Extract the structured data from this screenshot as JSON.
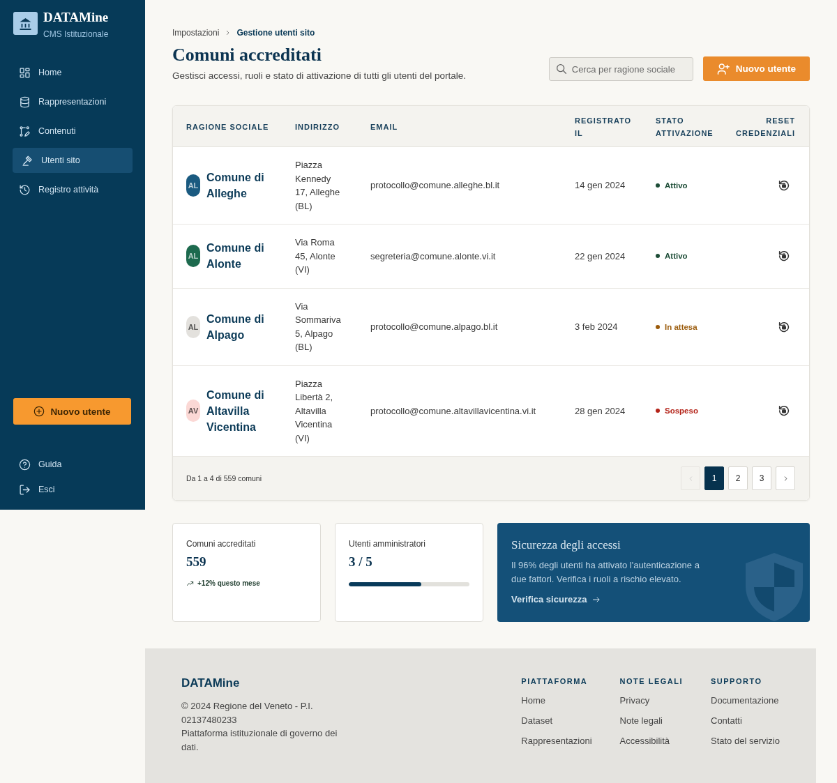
{
  "sidebar": {
    "brand": "DATAMine",
    "subtitle": "CMS Istituzionale",
    "nav": [
      {
        "label": "Home",
        "selected": false
      },
      {
        "label": "Rappresentazioni",
        "selected": false
      },
      {
        "label": "Contenuti",
        "selected": false
      },
      {
        "label": "Utenti sito",
        "selected": true
      },
      {
        "label": "Registro attività",
        "selected": false
      }
    ],
    "cta": "Nuovo utente",
    "bottom_nav": [
      {
        "label": "Guida"
      },
      {
        "label": "Esci"
      }
    ]
  },
  "breadcrumb": [
    {
      "label": "Impostazioni",
      "current": false
    },
    {
      "label": "Gestione utenti sito",
      "current": true
    }
  ],
  "title": "Comuni accreditati",
  "subtitle": "Gestisci accessi, ruoli e stato di attivazione di tutti gli utenti del portale.",
  "search": {
    "placeholder": "Cerca per ragione sociale"
  },
  "new_user_button": "Nuovo utente",
  "table": {
    "columns": [
      "RAGIONE SOCIALE",
      "INDIRIZZO",
      "EMAIL",
      "REGISTRATO IL",
      "STATO ATTIVAZIONE",
      "RESET CREDENZIALI"
    ],
    "rows": [
      {
        "avatar": {
          "initials": "AL",
          "color": "#1a5a80"
        },
        "name": "Comune di Alleghe",
        "address": "Piazza Kennedy 17, Alleghe (BL)",
        "email": "protocollo@comune.alleghe.bl.it",
        "registered": "14 gen 2024",
        "status": {
          "label": "Attivo",
          "color": "#1d4d37"
        }
      },
      {
        "avatar": {
          "initials": "AL",
          "color": "#1d6a4e"
        },
        "name": "Comune di Alonte",
        "address": "Via Roma 45, Alonte (VI)",
        "email": "segreteria@comune.alonte.vi.it",
        "registered": "22 gen 2024",
        "status": {
          "label": "Attivo",
          "color": "#1d4d37"
        }
      },
      {
        "avatar": {
          "initials": "AL",
          "color": "#e3e1dd"
        },
        "name": "Comune di Alpago",
        "address": "Via Sommariva 5, Alpago (BL)",
        "email": "protocollo@comune.alpago.bl.it",
        "registered": "3 feb 2024",
        "status": {
          "label": "In attesa",
          "color": "#9b5b0b"
        }
      },
      {
        "avatar": {
          "initials": "AV",
          "color": "#fbd8d5"
        },
        "name": "Comune di Altavilla Vicentina",
        "address": "Piazza Libertà 2, Altavilla Vicentina (VI)",
        "email": "protocollo@comune.altavillavicentina.vi.it",
        "registered": "28 gen 2024",
        "status": {
          "label": "Sospeso",
          "color": "#b42318"
        }
      }
    ]
  },
  "pagination": {
    "summary": "Da 1 a 4 di 559 comuni",
    "prev": {
      "disabled": true
    },
    "pages": [
      {
        "label": "1",
        "selected": true
      },
      {
        "label": "2",
        "selected": false
      },
      {
        "label": "3",
        "selected": false
      }
    ],
    "next": {
      "disabled": false
    }
  },
  "stats": [
    {
      "kind": "trend",
      "label": "Comuni accreditati",
      "value": "559",
      "trend": "+12% questo mese"
    },
    {
      "kind": "progress",
      "label": "Utenti amministratori",
      "value": "3 / 5",
      "level": 0.6
    }
  ],
  "security_card": {
    "title": "Sicurezza degli accessi",
    "text": "Il 96% degli utenti ha attivato l'autenticazione a due fattori. Verifica i ruoli a rischio elevato.",
    "link": "Verifica sicurezza"
  },
  "footer": {
    "brand": "DATAMine",
    "copyright": "© 2024 Regione del Veneto - P.I. 02137480233",
    "description": "Piattaforma istituzionale di governo dei dati.",
    "columns": [
      {
        "title": "PIATTAFORMA",
        "links": [
          "Home",
          "Dataset",
          "Rappresentazioni"
        ]
      },
      {
        "title": "NOTE LEGALI",
        "links": [
          "Privacy",
          "Note legali",
          "Accessibilità"
        ]
      },
      {
        "title": "SUPPORTO",
        "links": [
          "Documentazione",
          "Contatti",
          "Stato del servizio"
        ]
      }
    ]
  }
}
